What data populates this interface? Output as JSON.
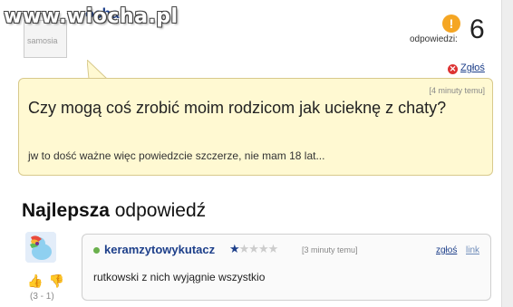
{
  "header": {
    "watermark": "www.wiocha.pl",
    "author_fragment": "ocha",
    "avatar_label": "samosia",
    "answers_label": "odpowiedzi:",
    "answers_count": "6",
    "info_icon": "!"
  },
  "question": {
    "report_label": "Zgłoś",
    "time": "[4 minuty temu]",
    "title": "Czy mogą coś zrobić moim rodzicom jak ucieknę z chaty?",
    "body": "jw to dość ważne więc powiedzcie szczerze, nie mam 18 lat..."
  },
  "best_answer": {
    "header_bold": "Najlepsza",
    "header_rest": " odpowiedź",
    "author": "keramzytowykutacz",
    "stars_filled": "★",
    "stars_empty": "★★★★",
    "rating_stars": 1,
    "rating_max": 5,
    "time": "[3 minuty temu]",
    "report_label": "zgłoś",
    "link_label": "link",
    "text": "rutkowski z nich wyjągnie wszystkio",
    "vote_score": "(3 - 1)"
  },
  "colors": {
    "question_bg": "#fff9d2",
    "link_blue": "#1d3f8a",
    "warning_orange": "#f5a623"
  },
  "icons": [
    "info-icon",
    "report-icon",
    "thumbs-up-icon",
    "thumbs-down-icon",
    "star-icon",
    "online-status-icon"
  ]
}
